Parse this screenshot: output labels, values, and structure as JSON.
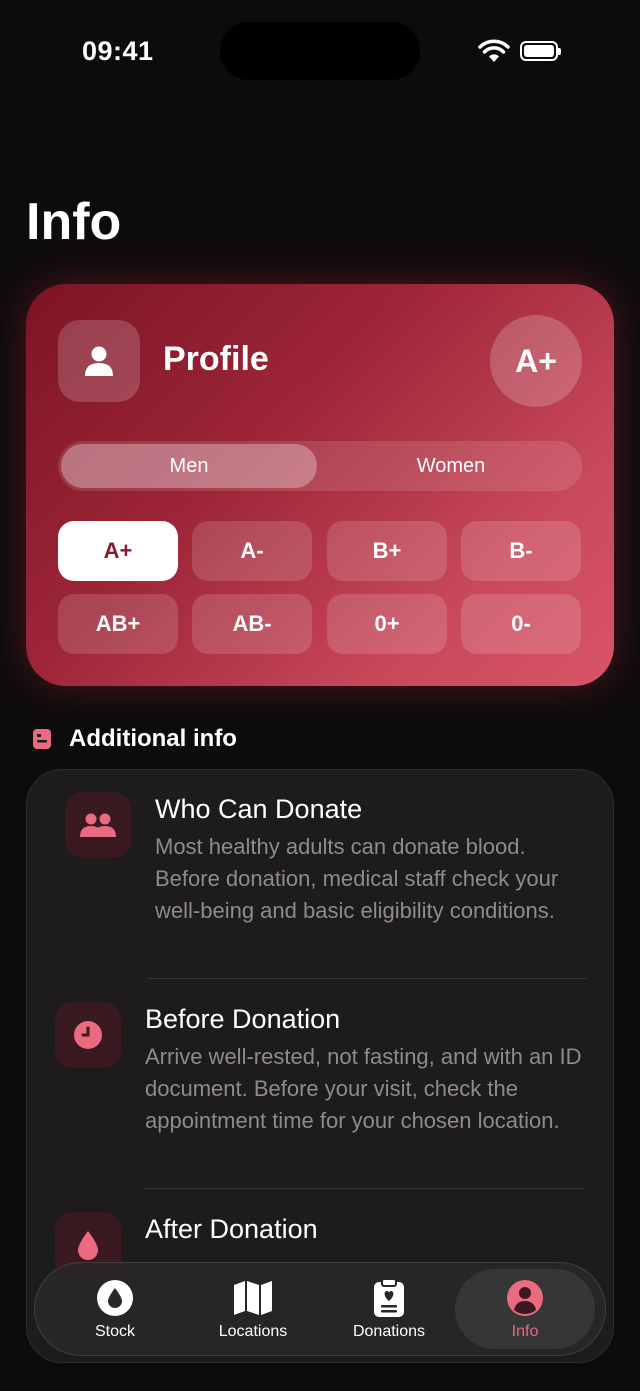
{
  "status": {
    "time": "09:41"
  },
  "page": {
    "title": "Info"
  },
  "profile": {
    "label": "Profile",
    "current_type": "A+",
    "segments": [
      "Men",
      "Women"
    ],
    "selected_segment": "Men",
    "blood_types": [
      "A+",
      "A-",
      "B+",
      "B-",
      "AB+",
      "AB-",
      "0+",
      "0-"
    ],
    "selected_type": "A+"
  },
  "additional": {
    "heading": "Additional info",
    "items": [
      {
        "title": "Who Can Donate",
        "text": "Most healthy adults can donate blood. Before donation, medical staff check your well-being and basic eligibility conditions.",
        "icon": "people-icon"
      },
      {
        "title": "Before Donation",
        "text": "Arrive well-rested, not fasting, and with an ID document. Before your visit, check the appointment time for your chosen location.",
        "icon": "clock-icon"
      },
      {
        "title": "After Donation",
        "text": "",
        "icon": "drop-icon"
      }
    ]
  },
  "tabs": [
    {
      "label": "Stock",
      "icon": "drop-icon"
    },
    {
      "label": "Locations",
      "icon": "map-icon"
    },
    {
      "label": "Donations",
      "icon": "clipboard-heart-icon"
    },
    {
      "label": "Info",
      "icon": "person-icon"
    }
  ],
  "colors": {
    "accent": "#ea6a80",
    "card_start": "#7c1425",
    "card_end": "#d95467",
    "background": "#0d0b0c"
  }
}
